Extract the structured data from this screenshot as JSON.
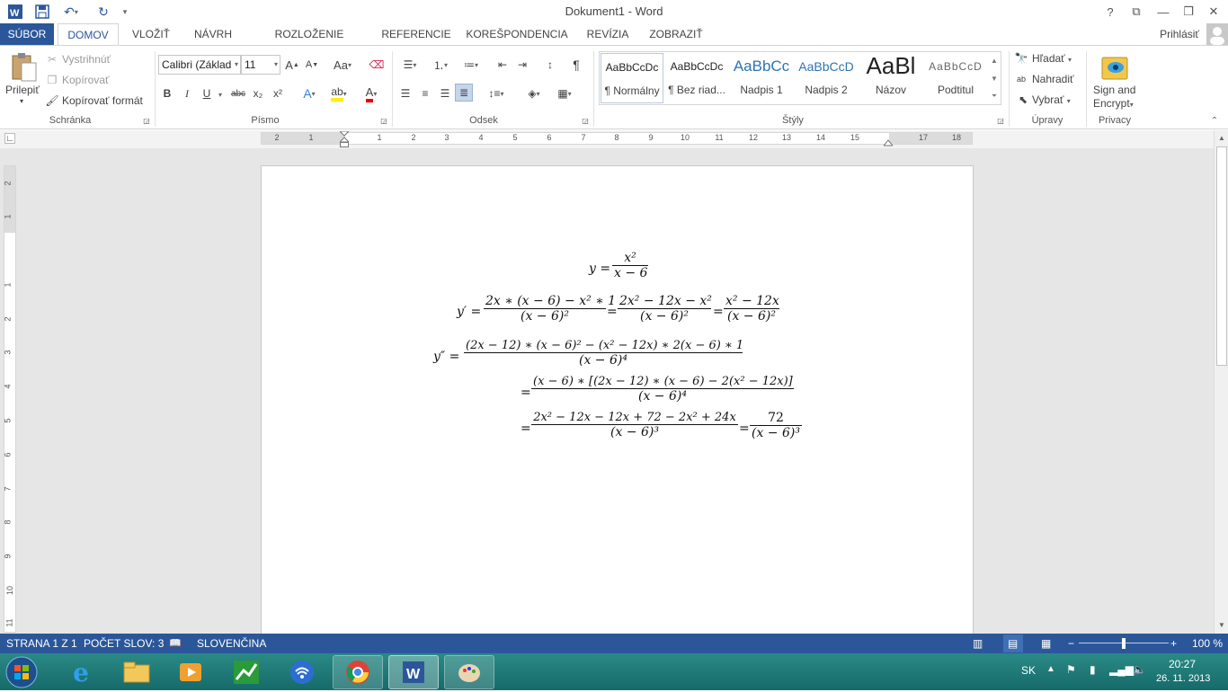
{
  "window": {
    "title": "Dokument1 - Word",
    "help": "?",
    "signin": "Prihlásiť"
  },
  "tabs": [
    "SÚBOR",
    "DOMOV",
    "VLOŽIŤ",
    "NÁVRH",
    "ROZLOŽENIE STRANY",
    "REFERENCIE",
    "KOREŠPONDENCIA",
    "REVÍZIA",
    "ZOBRAZIŤ"
  ],
  "clipboard": {
    "paste": "Prilepiť",
    "cut": "Vystrihnúť",
    "copy": "Kopírovať",
    "format_painter": "Kopírovať formát",
    "label": "Schránka"
  },
  "font": {
    "name": "Calibri (Základ",
    "size": "11",
    "label": "Písmo",
    "grow": "A",
    "shrink": "A",
    "case": "Aa",
    "bold": "B",
    "italic": "I",
    "underline": "U",
    "strike": "abc",
    "sub": "x₂",
    "sup": "x²"
  },
  "paragraph": {
    "label": "Odsek",
    "pilcrow": "¶"
  },
  "styles": {
    "label": "Štýly",
    "items": [
      {
        "preview": "AaBbCcDc",
        "name": "¶ Normálny"
      },
      {
        "preview": "AaBbCcDc",
        "name": "¶ Bez riad..."
      },
      {
        "preview": "AaBbCc",
        "name": "Nadpis 1"
      },
      {
        "preview": "AaBbCcD",
        "name": "Nadpis 2"
      },
      {
        "preview": "AaBl",
        "name": "Názov"
      },
      {
        "preview": "AaBbCcD",
        "name": "Podtitul"
      }
    ]
  },
  "editing": {
    "find": "Hľadať",
    "replace": "Nahradiť",
    "select": "Vybrať",
    "label": "Úpravy"
  },
  "privacy": {
    "sign": "Sign and",
    "encrypt": "Encrypt",
    "label": "Privacy"
  },
  "ruler": {
    "numbers": [
      "2",
      "1",
      "",
      "1",
      "2",
      "3",
      "4",
      "5",
      "6",
      "7",
      "8",
      "9",
      "10",
      "11",
      "12",
      "13",
      "14",
      "15",
      "",
      "17",
      "18"
    ],
    "vnumbers": [
      "2",
      "1",
      "",
      "1",
      "2",
      "3",
      "4",
      "5",
      "6",
      "7",
      "8",
      "9",
      "10",
      "11"
    ]
  },
  "math": {
    "l1_lhs": "y =",
    "l1_num": "x²",
    "l1_den": "x − 6",
    "l2_lhs": "y′ =",
    "l2_f1_num": "2x ∗ (x − 6) − x² ∗ 1",
    "l2_f1_den": "(x − 6)²",
    "l2_eq1": "=",
    "l2_f2_num": "2x² − 12x − x²",
    "l2_f2_den": "(x − 6)²",
    "l2_eq2": "=",
    "l2_f3_num": "x² − 12x",
    "l2_f3_den": "(x − 6)²",
    "l3_lhs": "y″ =",
    "l3_num": "(2x − 12) ∗ (x − 6)² − (x² − 12x) ∗ 2(x − 6) ∗ 1",
    "l3_den": "(x − 6)⁴",
    "l4_eq": "=",
    "l4_num": "(x − 6) ∗ [(2x − 12) ∗ (x − 6) − 2(x² − 12x)]",
    "l4_den": "(x − 6)⁴",
    "l5_eq": "=",
    "l5_num": "2x² − 12x − 12x + 72 − 2x² + 24x",
    "l5_den": "(x − 6)³",
    "l5_eq2": "=",
    "l5_f2_num": "72",
    "l5_f2_den": "(x − 6)³"
  },
  "status": {
    "page": "STRANA 1 Z 1",
    "words": "POČET SLOV: 3",
    "lang": "SLOVENČINA",
    "zoom": "100 %",
    "zoom_level": 0.5
  },
  "tray": {
    "lang": "SK",
    "time": "20:27",
    "date": "26. 11. 2013"
  },
  "colors": {
    "accent": "#2b579a",
    "taskbar": "#1f7a78"
  }
}
